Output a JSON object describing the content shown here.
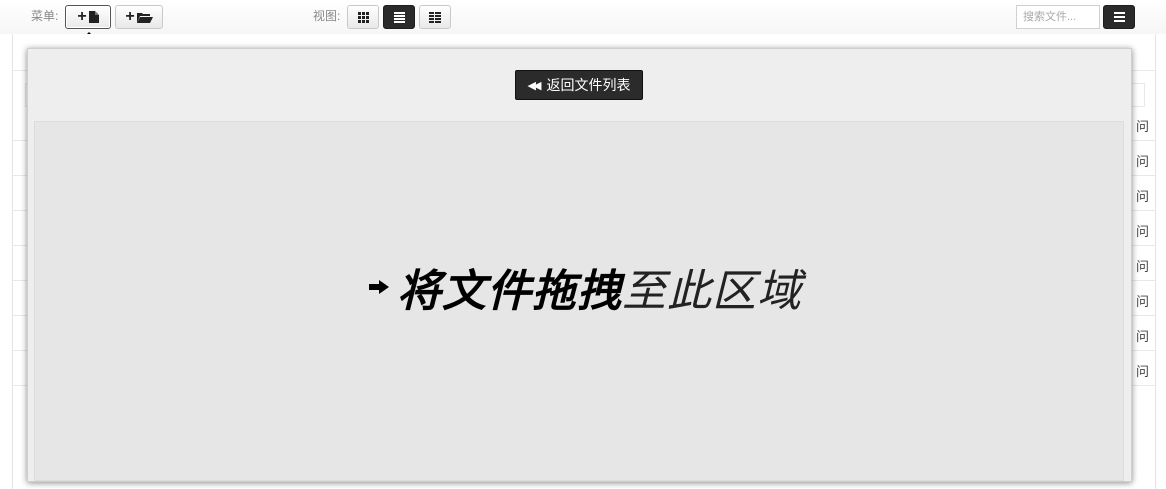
{
  "toolbar": {
    "menu_label": "菜单:",
    "view_label": "视图:",
    "search_placeholder": "搜索文件..."
  },
  "icons": {
    "new_file": "plus-file-icon",
    "new_folder": "plus-folder-icon",
    "view_grid": "grid-icon",
    "view_list": "list-icon",
    "view_detail": "detail-list-icon",
    "menu": "hamburger-icon",
    "back": "double-left-arrow-icon",
    "drop": "right-arrow-icon"
  },
  "upload": {
    "back_label": "返回文件列表",
    "drop_bold": "将文件拖拽",
    "drop_light": "至此区域"
  },
  "behind_rows": [
    {
      "tail": "问"
    },
    {
      "tail": "问"
    },
    {
      "tail": "问"
    },
    {
      "tail": "问"
    },
    {
      "tail": "问"
    },
    {
      "tail": "问"
    },
    {
      "tail": "问"
    },
    {
      "tail": "问"
    }
  ],
  "colors": {
    "overlay_bg": "#eeeeee",
    "drop_bg": "#e6e6e6",
    "dark_button": "#2b2b2b"
  }
}
